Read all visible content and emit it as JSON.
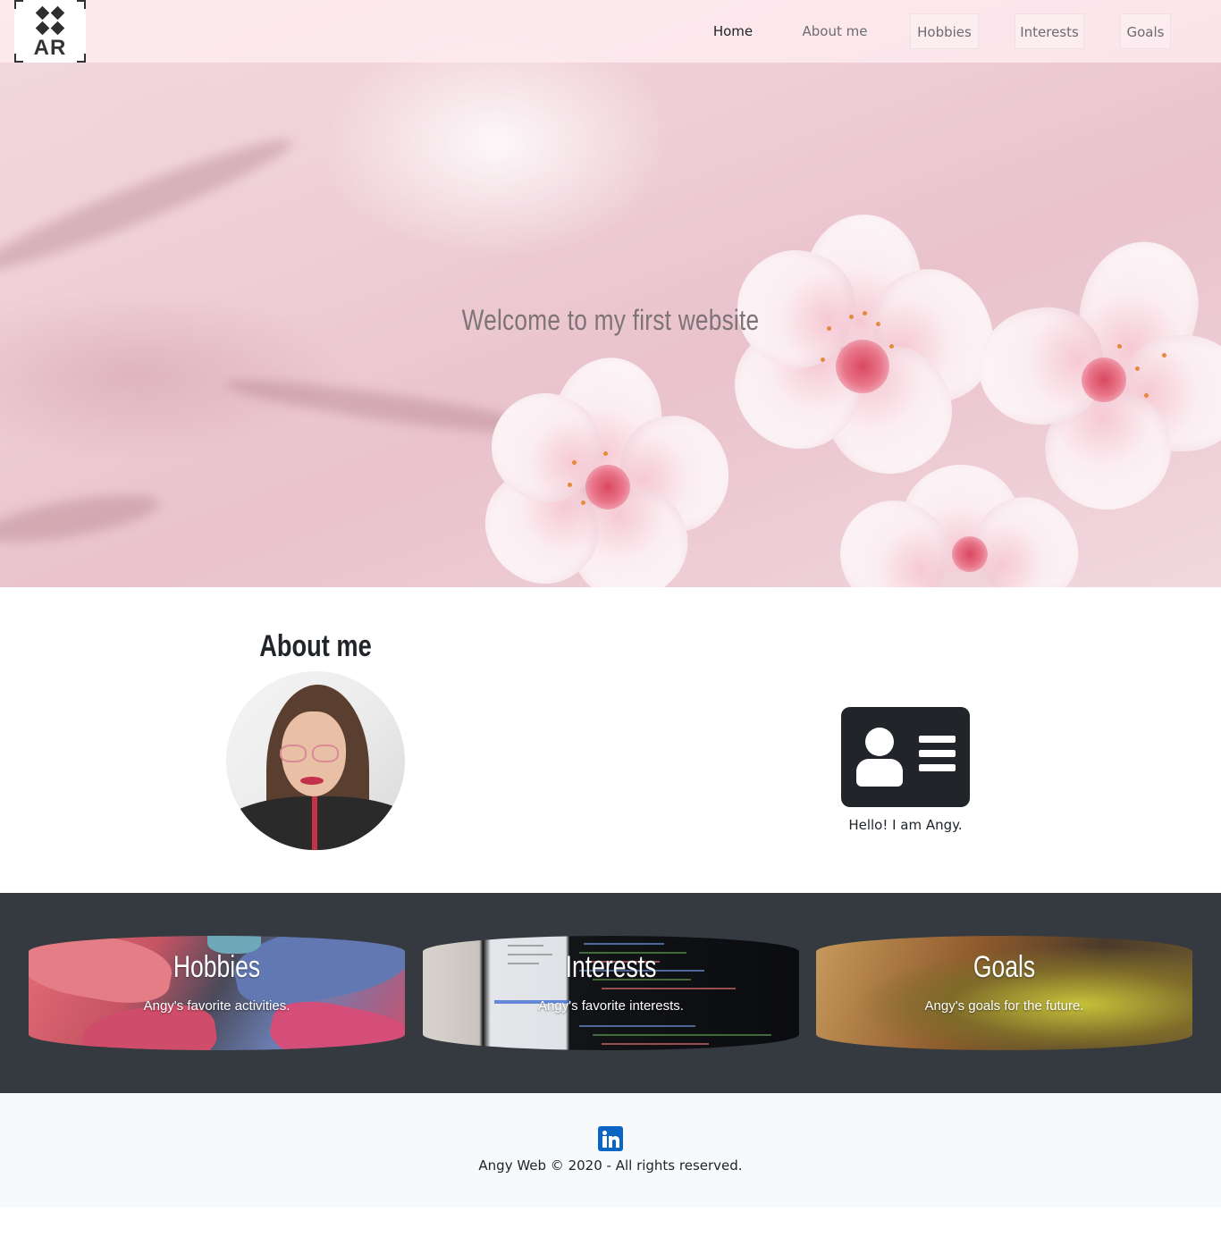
{
  "logo": {
    "text": "AR"
  },
  "nav": {
    "items": [
      {
        "label": "Home"
      },
      {
        "label": "About me"
      },
      {
        "label": "Hobbies"
      },
      {
        "label": "Interests"
      },
      {
        "label": "Goals"
      }
    ]
  },
  "hero": {
    "title": "Welcome to my first website"
  },
  "about": {
    "title": "About me",
    "greeting": "Hello! I am Angy."
  },
  "sections": [
    {
      "title": "Hobbies",
      "subtitle": "Angy's favorite activities."
    },
    {
      "title": "Interests",
      "subtitle": "Angy's favorite interests."
    },
    {
      "title": "Goals",
      "subtitle": "Angy's goals for the future."
    }
  ],
  "footer": {
    "copyright": "Angy Web © 2020 - All rights reserved."
  },
  "colors": {
    "dark_section": "#343a40",
    "footer_bg": "#f8f9fa",
    "linkedin": "#0a66c2"
  }
}
